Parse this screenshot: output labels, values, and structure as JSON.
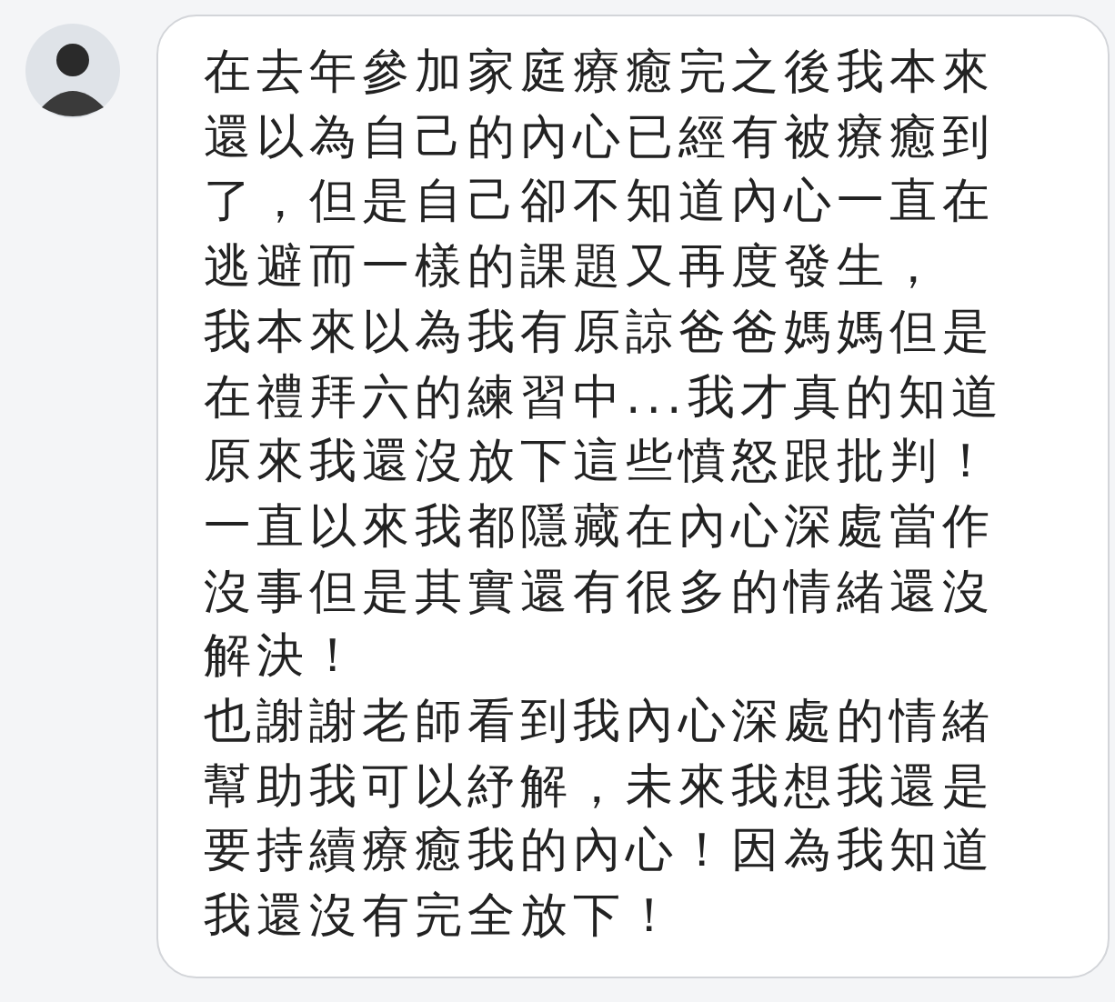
{
  "message": {
    "paragraphs": [
      "在去年參加家庭療癒完之後我本來還以為自己的內心已經有被療癒到了，但是自己卻不知道內心一直在逃避而一樣的課題又再度發生，",
      "我本來以為我有原諒爸爸媽媽但是在禮拜六的練習中...我才真的知道原來我還沒放下這些憤怒跟批判！",
      "一直以來我都隱藏在內心深處當作沒事但是其實還有很多的情緒還沒解決！",
      "也謝謝老師看到我內心深處的情緒幫助我可以紓解，未來我想我還是要持續療癒我的內心！因為我知道我還沒有完全放下！"
    ]
  }
}
